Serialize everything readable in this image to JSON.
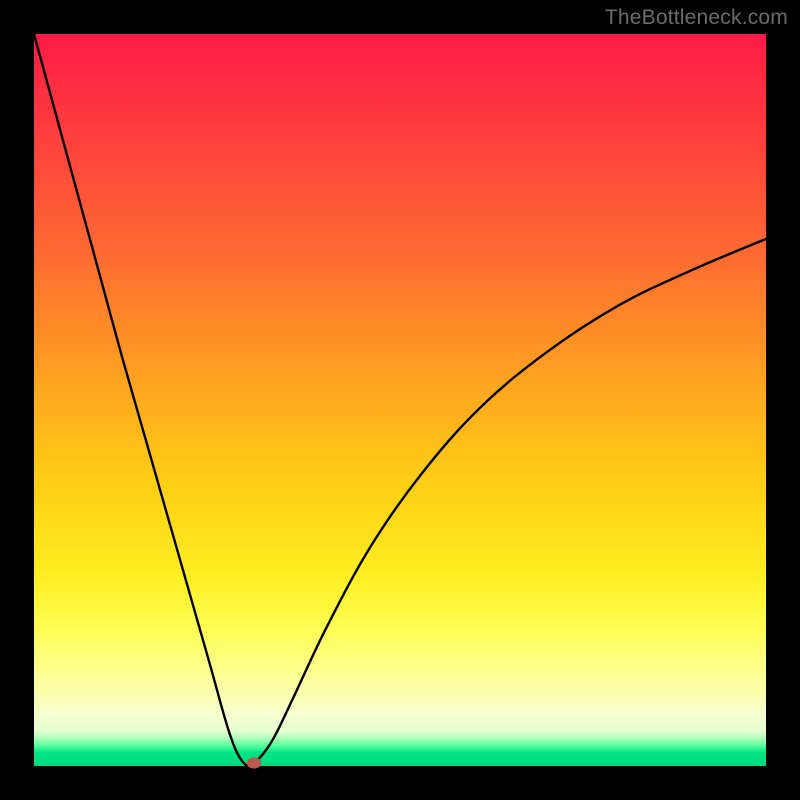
{
  "watermark": "TheBottleneck.com",
  "colors": {
    "frame": "#000000",
    "curve_stroke": "#000000",
    "marker_fill": "#b9584c",
    "gradient_top": "#ff1a47",
    "gradient_bottom": "#00d97f"
  },
  "chart_data": {
    "type": "line",
    "title": "",
    "xlabel": "",
    "ylabel": "",
    "xlim": [
      0,
      100
    ],
    "ylim": [
      0,
      100
    ],
    "grid": false,
    "legend": "none",
    "series": [
      {
        "name": "curve",
        "x": [
          0,
          3,
          6,
          9,
          12,
          15,
          18,
          21,
          24,
          26.7,
          28.5,
          30,
          32.5,
          35.5,
          40,
          46,
          53,
          61,
          70,
          80,
          90,
          100
        ],
        "y": [
          100,
          89,
          78,
          67,
          56,
          45.5,
          35,
          24.5,
          14,
          4.5,
          0.6,
          0.4,
          3.4,
          9.5,
          19,
          30,
          40,
          49,
          56.5,
          63,
          67.8,
          72
        ]
      }
    ],
    "annotations": [
      {
        "name": "min-marker",
        "x": 30,
        "y": 0.4
      }
    ]
  }
}
